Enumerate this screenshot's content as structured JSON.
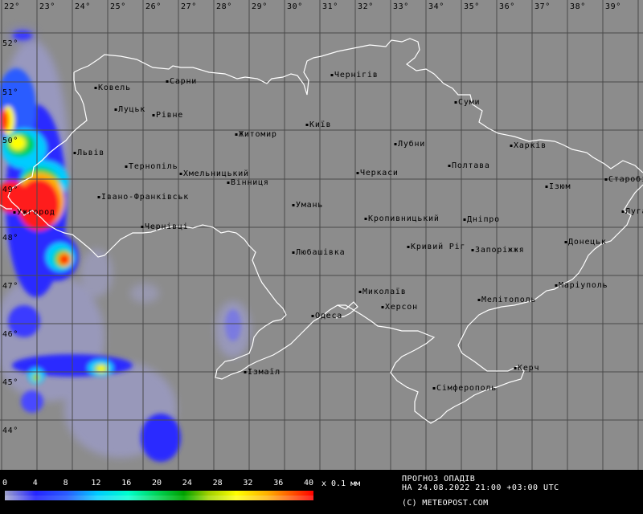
{
  "map": {
    "longitude_labels": [
      "22°",
      "23°",
      "24°",
      "25°",
      "26°",
      "27°",
      "28°",
      "29°",
      "30°",
      "31°",
      "32°",
      "33°",
      "34°",
      "35°",
      "36°",
      "37°",
      "38°",
      "39°"
    ],
    "latitude_labels": [
      "52°",
      "51°",
      "50°",
      "49°",
      "48°",
      "47°",
      "46°",
      "45°",
      "44°"
    ],
    "cities": [
      {
        "name": "Ковель"
      },
      {
        "name": "Сарни"
      },
      {
        "name": "Чернігів"
      },
      {
        "name": "Луцьк"
      },
      {
        "name": "Рівне"
      },
      {
        "name": "Суми"
      },
      {
        "name": "Київ"
      },
      {
        "name": "Житомир"
      },
      {
        "name": "Львів"
      },
      {
        "name": "Лубни"
      },
      {
        "name": "Харків"
      },
      {
        "name": "Тернопіль"
      },
      {
        "name": "Хмельницький"
      },
      {
        "name": "Черкаси"
      },
      {
        "name": "Полтава"
      },
      {
        "name": "Вінниця"
      },
      {
        "name": "Ізюм"
      },
      {
        "name": "Старобі"
      },
      {
        "name": "Івано-Франківськ"
      },
      {
        "name": "Ужгород"
      },
      {
        "name": "Умань"
      },
      {
        "name": "Кропивницький"
      },
      {
        "name": "Дніпро"
      },
      {
        "name": "Луганськ"
      },
      {
        "name": "Чернівці"
      },
      {
        "name": "Донецьк"
      },
      {
        "name": "Кривий Ріг"
      },
      {
        "name": "Запоріжжя"
      },
      {
        "name": "Любашівка"
      },
      {
        "name": "Маріуполь"
      },
      {
        "name": "Миколаїв"
      },
      {
        "name": "Мелітополь"
      },
      {
        "name": "Херсон"
      },
      {
        "name": "Одеса"
      },
      {
        "name": "Керч"
      },
      {
        "name": "Ізмаїл"
      },
      {
        "name": "Сімферополь"
      }
    ]
  },
  "legend": {
    "scale_values": [
      "0",
      "4",
      "8",
      "12",
      "16",
      "20",
      "24",
      "28",
      "32",
      "36",
      "40"
    ],
    "unit": "x 0.1 мм",
    "colors": [
      "#9ea0c8",
      "#2525ff",
      "#00ccff",
      "#00ffcc",
      "#00a000",
      "#ffff00",
      "#ff0000"
    ]
  },
  "header": {
    "title": "ПРОГНОЗ ОПАДІВ",
    "date_line": "НА 24.08.2022 21:00 +03:00 UTC",
    "copyright": "(C) METEOPOST.COM"
  }
}
